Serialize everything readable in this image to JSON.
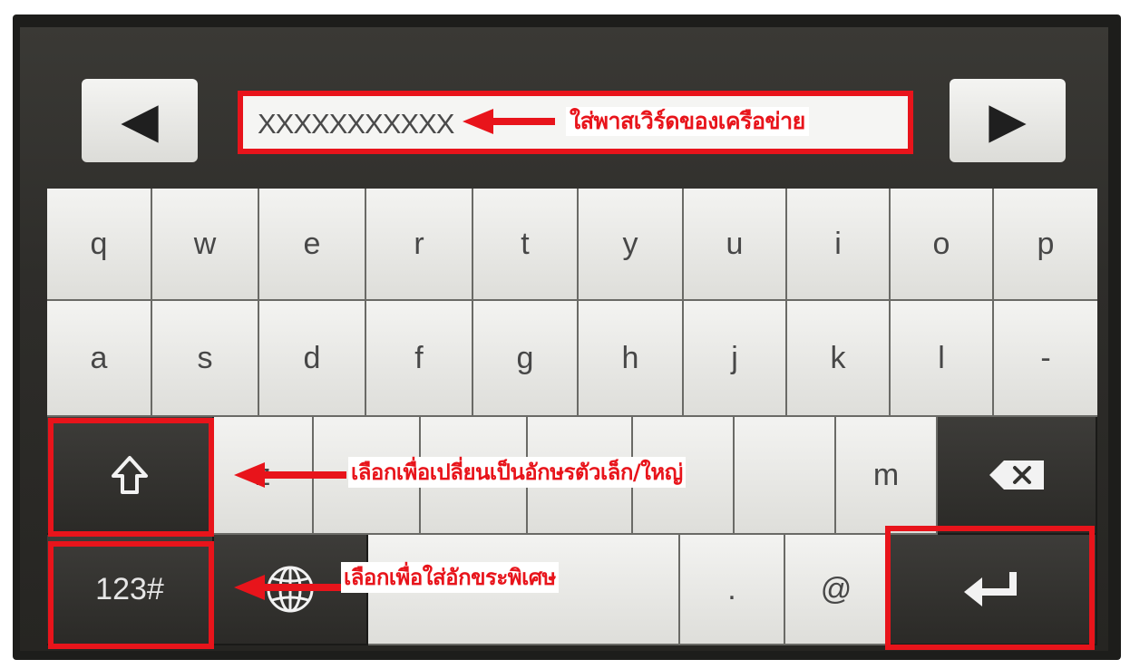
{
  "nav": {
    "left_glyph": "◀",
    "right_glyph": "▶"
  },
  "password_field": {
    "value": "XXXXXXXXXXX"
  },
  "callouts": {
    "network_password": "ใส่พาสเวิร์ดของเครือข่าย",
    "toggle_case": "เลือกเพื่อเปลี่ยนเป็นอักษรตัวเล็ก/ใหญ่",
    "special_chars": "เลือกเพื่อใส่อักขระพิเศษ"
  },
  "keyboard": {
    "row1": [
      "q",
      "w",
      "e",
      "r",
      "t",
      "y",
      "u",
      "i",
      "o",
      "p"
    ],
    "row2": [
      "a",
      "s",
      "d",
      "f",
      "g",
      "h",
      "j",
      "k",
      "l",
      "-"
    ],
    "row3_visible": [
      "z",
      "m"
    ],
    "row4": {
      "symbols_label": "123#",
      "period": ".",
      "at": "@"
    }
  },
  "icons": {
    "shift": "shift-arrow-icon",
    "backspace": "backspace-icon",
    "language": "globe-icon",
    "enter": "enter-icon"
  },
  "colors": {
    "annotation_red": "#e8141b",
    "key_light": "#ebebe8",
    "key_dark": "#33322f",
    "bezel": "#1d1d1b"
  }
}
